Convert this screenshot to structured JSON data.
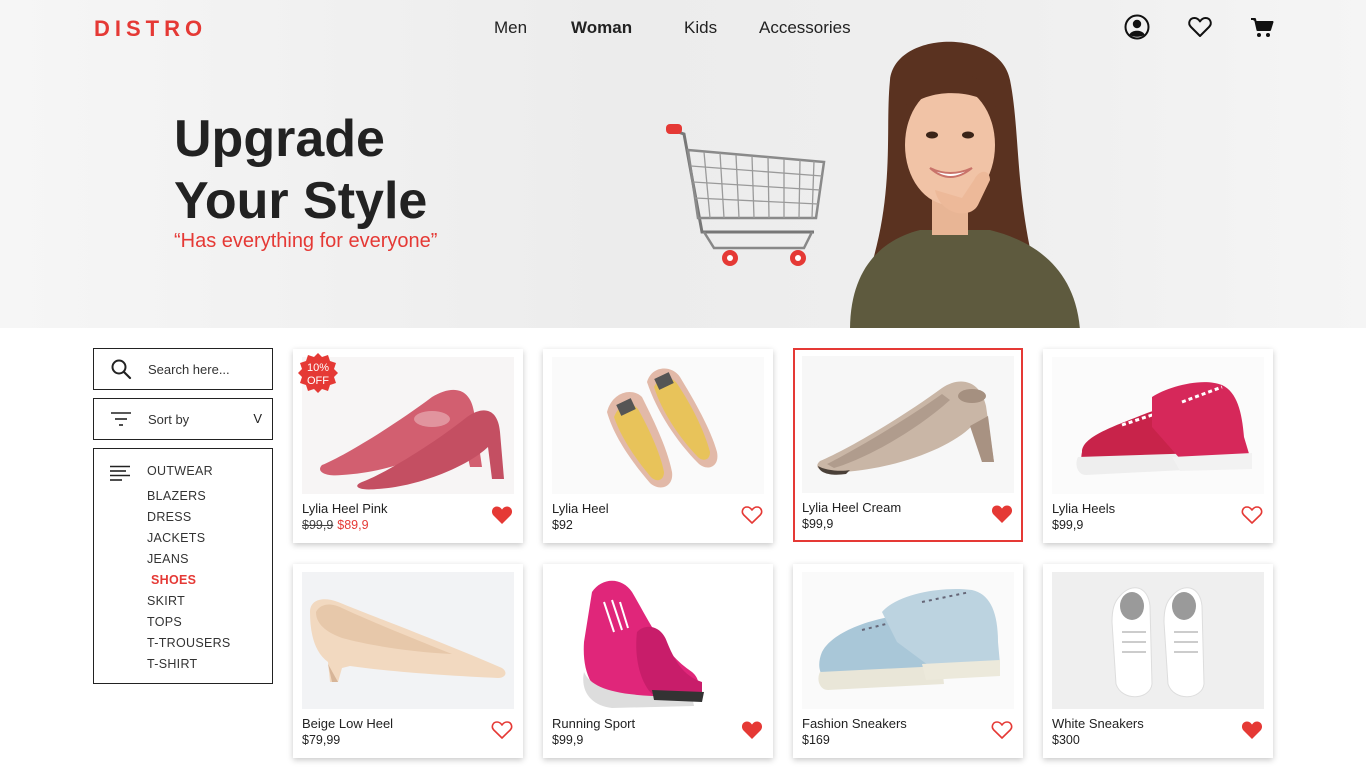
{
  "brand": "DISTRO",
  "nav": {
    "men": "Men",
    "woman": "Woman",
    "kids": "Kids",
    "accessories": "Accessories"
  },
  "hero": {
    "line1": "Upgrade",
    "line2": "Your Style",
    "tagline": "“Has everything for everyone”"
  },
  "search": {
    "placeholder": "Search here..."
  },
  "sort": {
    "label": "Sort by",
    "chevron": "V"
  },
  "categories": [
    "OUTWEAR",
    "BLAZERS",
    "DRESS",
    "JACKETS",
    "JEANS",
    "SHOES",
    "SKIRT",
    "TOPS",
    "T-TROUSERS",
    "T-SHIRT"
  ],
  "active_category": "SHOES",
  "badge": {
    "line1": "10%",
    "line2": "OFF"
  },
  "products": [
    {
      "name": "Lylia Heel Pink",
      "old_price": "$99,9",
      "price": "$89,9",
      "favorited": true
    },
    {
      "name": "Lylia Heel",
      "price": "$92",
      "favorited": false
    },
    {
      "name": "Lylia Heel Cream",
      "price": "$99,9",
      "favorited": true,
      "selected": true
    },
    {
      "name": "Lylia Heels",
      "price": "$99,9",
      "favorited": false
    },
    {
      "name": "Beige Low Heel",
      "price": "$79,99",
      "favorited": false
    },
    {
      "name": "Running Sport",
      "price": "$99,9",
      "favorited": true
    },
    {
      "name": "Fashion Sneakers",
      "price": "$169",
      "favorited": false
    },
    {
      "name": "White Sneakers",
      "price": "$300",
      "favorited": true
    }
  ],
  "colors": {
    "accent": "#e53935",
    "text": "#222222"
  },
  "icons": {
    "account": "user-circle-icon",
    "wishlist": "heart-icon",
    "cart": "cart-icon"
  }
}
